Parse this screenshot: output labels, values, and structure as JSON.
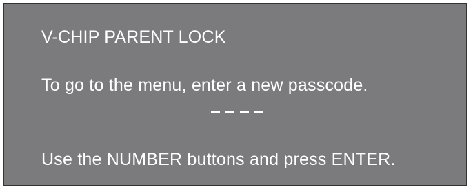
{
  "menu": {
    "title": "V-CHIP PARENT LOCK",
    "prompt": "To go to the menu, enter a new passcode.",
    "passcode_slots": [
      "–",
      "–",
      "–",
      "–"
    ],
    "instruction": "Use the NUMBER buttons and press ENTER."
  },
  "colors": {
    "background": "#7b7b7e",
    "border": "#333333",
    "text": "#ffffff"
  }
}
